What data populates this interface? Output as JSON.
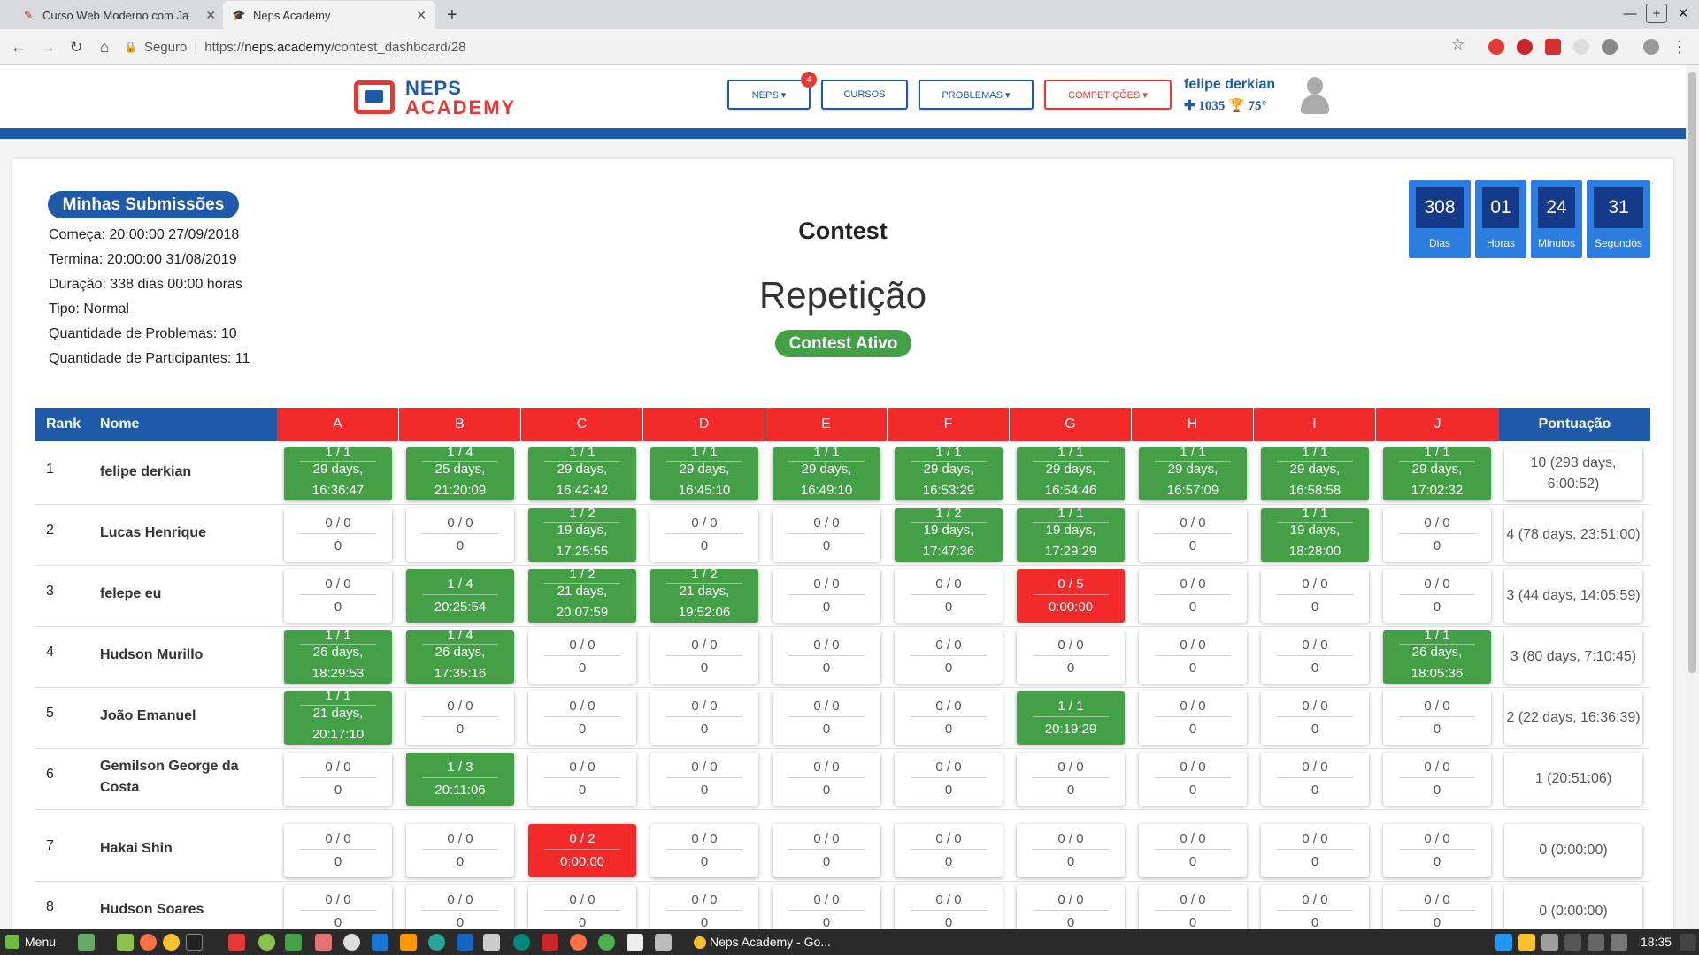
{
  "browser": {
    "tabs": [
      {
        "title": "Curso Web Moderno com Ja",
        "icon": "course-icon"
      },
      {
        "title": "Neps Academy",
        "icon": "graduation-cap-icon"
      }
    ],
    "address": {
      "secure_label": "Seguro",
      "url_scheme": "https://",
      "url_host": "neps.academy",
      "url_path": "/contest_dashboard/28"
    }
  },
  "header": {
    "logo_line1": "NEPS",
    "logo_line2": "ACADEMY",
    "nav": [
      {
        "label": "NEPS ▾"
      },
      {
        "label": "CURSOS"
      },
      {
        "label": "PROBLEMAS ▾"
      },
      {
        "label": "COMPETIÇÕES ▾"
      }
    ],
    "notification_count": "4",
    "user": {
      "name": "felipe derkian",
      "points": "1035",
      "rank": "75°"
    }
  },
  "contest": {
    "submissions_button": "Minhas Submissões",
    "info": [
      "Começa: 20:00:00 27/09/2018",
      "Termina: 20:00:00 31/08/2019",
      "Duração: 338 dias 00:00 horas",
      "Tipo: Normal",
      "Quantidade de Problemas: 10",
      "Quantidade de Participantes: 11"
    ],
    "heading": "Contest",
    "name": "Repetição",
    "status": "Contest Ativo",
    "countdown": [
      {
        "value": "308",
        "label": "Dias"
      },
      {
        "value": "01",
        "label": "Horas"
      },
      {
        "value": "24",
        "label": "Minutos"
      },
      {
        "value": "31",
        "label": "Segundos"
      }
    ]
  },
  "scoreboard": {
    "col_rank": "Rank",
    "col_name": "Nome",
    "problems": [
      "A",
      "B",
      "C",
      "D",
      "E",
      "F",
      "G",
      "H",
      "I",
      "J"
    ],
    "col_score": "Pontuação",
    "rows": [
      {
        "rank": "1",
        "name": "felipe derkian",
        "score": "10 (293 days, 6:00:52)",
        "cells": [
          {
            "s": "green",
            "top": "1 / 1",
            "bot": "29 days, 16:36:47"
          },
          {
            "s": "green",
            "top": "1 / 4",
            "bot": "25 days, 21:20:09"
          },
          {
            "s": "green",
            "top": "1 / 1",
            "bot": "29 days, 16:42:42"
          },
          {
            "s": "green",
            "top": "1 / 1",
            "bot": "29 days, 16:45:10"
          },
          {
            "s": "green",
            "top": "1 / 1",
            "bot": "29 days, 16:49:10"
          },
          {
            "s": "green",
            "top": "1 / 1",
            "bot": "29 days, 16:53:29"
          },
          {
            "s": "green",
            "top": "1 / 1",
            "bot": "29 days, 16:54:46"
          },
          {
            "s": "green",
            "top": "1 / 1",
            "bot": "29 days, 16:57:09"
          },
          {
            "s": "green",
            "top": "1 / 1",
            "bot": "29 days, 16:58:58"
          },
          {
            "s": "green",
            "top": "1 / 1",
            "bot": "29 days, 17:02:32"
          }
        ]
      },
      {
        "rank": "2",
        "name": "Lucas Henrique",
        "score": "4 (78 days, 23:51:00)",
        "cells": [
          {
            "s": "none",
            "top": "0 / 0",
            "bot": "0"
          },
          {
            "s": "none",
            "top": "0 / 0",
            "bot": "0"
          },
          {
            "s": "green",
            "top": "1 / 2",
            "bot": "19 days, 17:25:55"
          },
          {
            "s": "none",
            "top": "0 / 0",
            "bot": "0"
          },
          {
            "s": "none",
            "top": "0 / 0",
            "bot": "0"
          },
          {
            "s": "green",
            "top": "1 / 2",
            "bot": "19 days, 17:47:36"
          },
          {
            "s": "green",
            "top": "1 / 1",
            "bot": "19 days, 17:29:29"
          },
          {
            "s": "none",
            "top": "0 / 0",
            "bot": "0"
          },
          {
            "s": "green",
            "top": "1 / 1",
            "bot": "19 days, 18:28:00"
          },
          {
            "s": "none",
            "top": "0 / 0",
            "bot": "0"
          }
        ]
      },
      {
        "rank": "3",
        "name": "felepe eu",
        "score": "3 (44 days, 14:05:59)",
        "cells": [
          {
            "s": "none",
            "top": "0 / 0",
            "bot": "0"
          },
          {
            "s": "green",
            "top": "1 / 4",
            "bot": "20:25:54"
          },
          {
            "s": "green",
            "top": "1 / 2",
            "bot": "21 days, 20:07:59"
          },
          {
            "s": "green",
            "top": "1 / 2",
            "bot": "21 days, 19:52:06"
          },
          {
            "s": "none",
            "top": "0 / 0",
            "bot": "0"
          },
          {
            "s": "none",
            "top": "0 / 0",
            "bot": "0"
          },
          {
            "s": "red",
            "top": "0 / 5",
            "bot": "0:00:00"
          },
          {
            "s": "none",
            "top": "0 / 0",
            "bot": "0"
          },
          {
            "s": "none",
            "top": "0 / 0",
            "bot": "0"
          },
          {
            "s": "none",
            "top": "0 / 0",
            "bot": "0"
          }
        ]
      },
      {
        "rank": "4",
        "name": "Hudson Murillo",
        "score": "3 (80 days, 7:10:45)",
        "cells": [
          {
            "s": "green",
            "top": "1 / 1",
            "bot": "26 days, 18:29:53"
          },
          {
            "s": "green",
            "top": "1 / 4",
            "bot": "26 days, 17:35:16"
          },
          {
            "s": "none",
            "top": "0 / 0",
            "bot": "0"
          },
          {
            "s": "none",
            "top": "0 / 0",
            "bot": "0"
          },
          {
            "s": "none",
            "top": "0 / 0",
            "bot": "0"
          },
          {
            "s": "none",
            "top": "0 / 0",
            "bot": "0"
          },
          {
            "s": "none",
            "top": "0 / 0",
            "bot": "0"
          },
          {
            "s": "none",
            "top": "0 / 0",
            "bot": "0"
          },
          {
            "s": "none",
            "top": "0 / 0",
            "bot": "0"
          },
          {
            "s": "green",
            "top": "1 / 1",
            "bot": "26 days, 18:05:36"
          }
        ]
      },
      {
        "rank": "5",
        "name": "João Emanuel",
        "score": "2 (22 days, 16:36:39)",
        "cells": [
          {
            "s": "green",
            "top": "1 / 1",
            "bot": "21 days, 20:17:10"
          },
          {
            "s": "none",
            "top": "0 / 0",
            "bot": "0"
          },
          {
            "s": "none",
            "top": "0 / 0",
            "bot": "0"
          },
          {
            "s": "none",
            "top": "0 / 0",
            "bot": "0"
          },
          {
            "s": "none",
            "top": "0 / 0",
            "bot": "0"
          },
          {
            "s": "none",
            "top": "0 / 0",
            "bot": "0"
          },
          {
            "s": "green",
            "top": "1 / 1",
            "bot": "20:19:29"
          },
          {
            "s": "none",
            "top": "0 / 0",
            "bot": "0"
          },
          {
            "s": "none",
            "top": "0 / 0",
            "bot": "0"
          },
          {
            "s": "none",
            "top": "0 / 0",
            "bot": "0"
          }
        ]
      },
      {
        "rank": "6",
        "name": "Gemilson George da Costa",
        "score": "1 (20:51:06)",
        "cells": [
          {
            "s": "none",
            "top": "0 / 0",
            "bot": "0"
          },
          {
            "s": "green",
            "top": "1 / 3",
            "bot": "20:11:06"
          },
          {
            "s": "none",
            "top": "0 / 0",
            "bot": "0"
          },
          {
            "s": "none",
            "top": "0 / 0",
            "bot": "0"
          },
          {
            "s": "none",
            "top": "0 / 0",
            "bot": "0"
          },
          {
            "s": "none",
            "top": "0 / 0",
            "bot": "0"
          },
          {
            "s": "none",
            "top": "0 / 0",
            "bot": "0"
          },
          {
            "s": "none",
            "top": "0 / 0",
            "bot": "0"
          },
          {
            "s": "none",
            "top": "0 / 0",
            "bot": "0"
          },
          {
            "s": "none",
            "top": "0 / 0",
            "bot": "0"
          }
        ]
      },
      {
        "rank": "7",
        "name": "Hakai Shin",
        "score": "0 (0:00:00)",
        "cells": [
          {
            "s": "none",
            "top": "0 / 0",
            "bot": "0"
          },
          {
            "s": "none",
            "top": "0 / 0",
            "bot": "0"
          },
          {
            "s": "red",
            "top": "0 / 2",
            "bot": "0:00:00"
          },
          {
            "s": "none",
            "top": "0 / 0",
            "bot": "0"
          },
          {
            "s": "none",
            "top": "0 / 0",
            "bot": "0"
          },
          {
            "s": "none",
            "top": "0 / 0",
            "bot": "0"
          },
          {
            "s": "none",
            "top": "0 / 0",
            "bot": "0"
          },
          {
            "s": "none",
            "top": "0 / 0",
            "bot": "0"
          },
          {
            "s": "none",
            "top": "0 / 0",
            "bot": "0"
          },
          {
            "s": "none",
            "top": "0 / 0",
            "bot": "0"
          }
        ]
      },
      {
        "rank": "8",
        "name": "Hudson Soares",
        "score": "0 (0:00:00)",
        "cells": [
          {
            "s": "none",
            "top": "0 / 0",
            "bot": "0"
          },
          {
            "s": "none",
            "top": "0 / 0",
            "bot": "0"
          },
          {
            "s": "none",
            "top": "0 / 0",
            "bot": "0"
          },
          {
            "s": "none",
            "top": "0 / 0",
            "bot": "0"
          },
          {
            "s": "none",
            "top": "0 / 0",
            "bot": "0"
          },
          {
            "s": "none",
            "top": "0 / 0",
            "bot": "0"
          },
          {
            "s": "none",
            "top": "0 / 0",
            "bot": "0"
          },
          {
            "s": "none",
            "top": "0 / 0",
            "bot": "0"
          },
          {
            "s": "none",
            "top": "0 / 0",
            "bot": "0"
          },
          {
            "s": "none",
            "top": "0 / 0",
            "bot": "0"
          }
        ]
      }
    ]
  },
  "taskbar": {
    "menu_label": "Menu",
    "window_title": "Neps Academy - Go...",
    "clock": "18:35"
  },
  "colors": {
    "brand_blue": "#1e5aa8",
    "accepted_green": "#43a047",
    "wrong_red": "#f42a2a"
  }
}
